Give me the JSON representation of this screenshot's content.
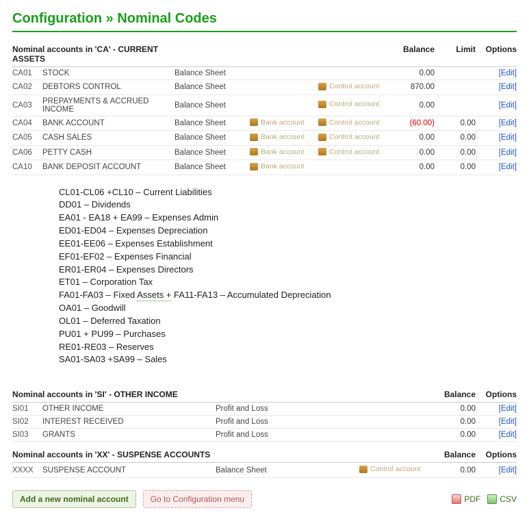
{
  "title": "Configuration » Nominal Codes",
  "headers": {
    "balance": "Balance",
    "limit": "Limit",
    "options": "Options"
  },
  "edit_label": "[Edit]",
  "bank_label": "Bank account",
  "control_label": "Control account",
  "sections": [
    {
      "label": "Nominal accounts in 'CA' - CURRENT ASSETS",
      "show_limit": true,
      "rows": [
        {
          "code": "CA01",
          "name": "STOCK",
          "type": "Balance Sheet",
          "bank": false,
          "control": false,
          "balance": "0.00",
          "limit": ""
        },
        {
          "code": "CA02",
          "name": "DEBTORS CONTROL",
          "type": "Balance Sheet",
          "bank": false,
          "control": true,
          "balance": "870.00",
          "limit": ""
        },
        {
          "code": "CA03",
          "name": "PREPAYMENTS & ACCRUED INCOME",
          "type": "Balance Sheet",
          "bank": false,
          "control": true,
          "balance": "0.00",
          "limit": ""
        },
        {
          "code": "CA04",
          "name": "BANK ACCOUNT",
          "type": "Balance Sheet",
          "bank": true,
          "control": true,
          "balance": "(60.00)",
          "neg": true,
          "limit": "0.00"
        },
        {
          "code": "CA05",
          "name": "CASH SALES",
          "type": "Balance Sheet",
          "bank": true,
          "control": true,
          "balance": "0.00",
          "limit": "0.00"
        },
        {
          "code": "CA06",
          "name": "PETTY CASH",
          "type": "Balance Sheet",
          "bank": true,
          "control": true,
          "balance": "0.00",
          "limit": "0.00"
        },
        {
          "code": "CA10",
          "name": "BANK DEPOSIT ACCOUNT",
          "type": "Balance Sheet",
          "bank": true,
          "control": false,
          "balance": "0.00",
          "limit": "0.00"
        }
      ]
    },
    {
      "label": "Nominal accounts in 'SI' - OTHER INCOME",
      "show_limit": false,
      "rows": [
        {
          "code": "SI01",
          "name": "OTHER INCOME",
          "type": "Profit and Loss",
          "bank": false,
          "control": false,
          "balance": "0.00"
        },
        {
          "code": "SI02",
          "name": "INTEREST RECEIVED",
          "type": "Profit and Loss",
          "bank": false,
          "control": false,
          "balance": "0.00"
        },
        {
          "code": "SI03",
          "name": "GRANTS",
          "type": "Profit and Loss",
          "bank": false,
          "control": false,
          "balance": "0.00"
        }
      ]
    },
    {
      "label": "Nominal accounts in 'XX' - SUSPENSE ACCOUNTS",
      "show_limit": false,
      "rows": [
        {
          "code": "XXXX",
          "name": "SUSPENSE ACCOUNT",
          "type": "Balance Sheet",
          "bank": false,
          "control": true,
          "balance": "0.00"
        }
      ]
    }
  ],
  "notes": [
    {
      "text": "CL01-CL06 +CL10 – Current Liabilities"
    },
    {
      "text": "DD01 – Dividends"
    },
    {
      "text": "EA01 - EA18 + EA99 – Expenses Admin"
    },
    {
      "text": "ED01-ED04 – Expenses Depreciation"
    },
    {
      "text": "EE01-EE06 – Expenses Establishment"
    },
    {
      "text": "EF01-EF02 – Expenses Financial"
    },
    {
      "text": "ER01-ER04 – Expenses Directors"
    },
    {
      "text": "ET01 – Corporation Tax"
    },
    {
      "pre": "FA01-FA03 – Fixed ",
      "dotted": "Assets  +",
      "post": " FA11-FA13 – Accumulated Depreciation"
    },
    {
      "text": "OA01 – Goodwill"
    },
    {
      "text": "OL01 – Deferred Taxation"
    },
    {
      "text": "PU01 + PU99 – Purchases"
    },
    {
      "text": "RE01-RE03 – Reserves"
    },
    {
      "text": "SA01-SA03 +SA99 – Sales"
    }
  ],
  "footer": {
    "add": "Add a new nominal account",
    "config": "Go to Configuration menu",
    "pdf": "PDF",
    "csv": "CSV"
  }
}
